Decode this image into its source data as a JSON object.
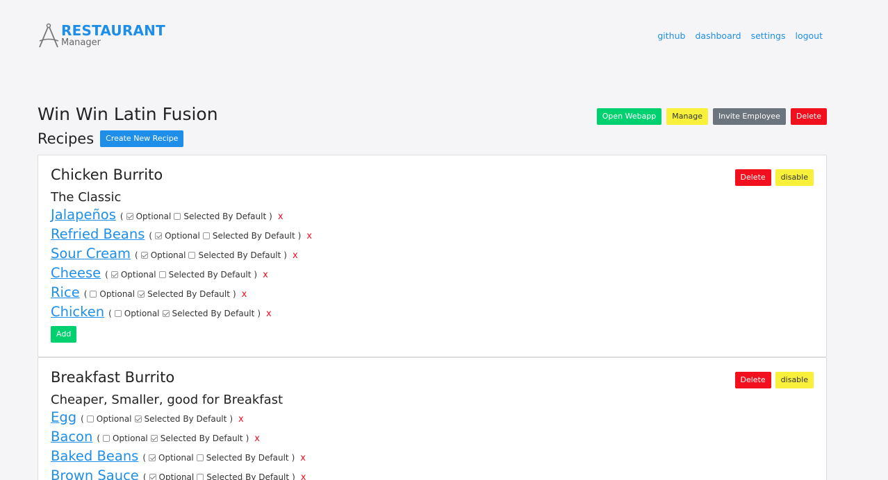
{
  "brand": {
    "title": "RESTAURANT",
    "subtitle": "Manager",
    "icon": "compass-a-logo"
  },
  "nav": [
    "github",
    "dashboard",
    "settings",
    "logout"
  ],
  "restaurant": {
    "name": "Win Win Latin Fusion",
    "actions": {
      "open_webapp": "Open Webapp",
      "manage": "Manage",
      "invite_employee": "Invite Employee",
      "delete": "Delete"
    }
  },
  "recipes": {
    "heading": "Recipes",
    "create_label": "Create New Recipe",
    "option_labels": {
      "optional": "Optional",
      "selected_by_default": "Selected By Default",
      "open_paren": "(",
      "close_paren": ")",
      "remove": "x"
    },
    "card_actions": {
      "delete": "Delete",
      "disable": "disable",
      "add": "Add"
    },
    "items": [
      {
        "name": "Chicken Burrito",
        "description": "The Classic",
        "ingredients": [
          {
            "name": "Jalapeños",
            "optional": true,
            "selected_by_default": false
          },
          {
            "name": "Refried Beans",
            "optional": true,
            "selected_by_default": false
          },
          {
            "name": "Sour Cream",
            "optional": true,
            "selected_by_default": false
          },
          {
            "name": "Cheese",
            "optional": true,
            "selected_by_default": false
          },
          {
            "name": "Rice",
            "optional": false,
            "selected_by_default": true
          },
          {
            "name": "Chicken",
            "optional": false,
            "selected_by_default": true
          }
        ]
      },
      {
        "name": "Breakfast Burrito",
        "description": "Cheaper, Smaller, good for Breakfast",
        "ingredients": [
          {
            "name": "Egg",
            "optional": false,
            "selected_by_default": true
          },
          {
            "name": "Bacon",
            "optional": false,
            "selected_by_default": true
          },
          {
            "name": "Baked Beans",
            "optional": true,
            "selected_by_default": false
          },
          {
            "name": "Brown Sauce",
            "optional": true,
            "selected_by_default": false
          }
        ]
      }
    ]
  },
  "colors": {
    "accent": "#1f8ee8",
    "success": "#00d170",
    "warning": "#f8f03a",
    "danger": "#f2101f",
    "secondary": "#6c757d"
  }
}
